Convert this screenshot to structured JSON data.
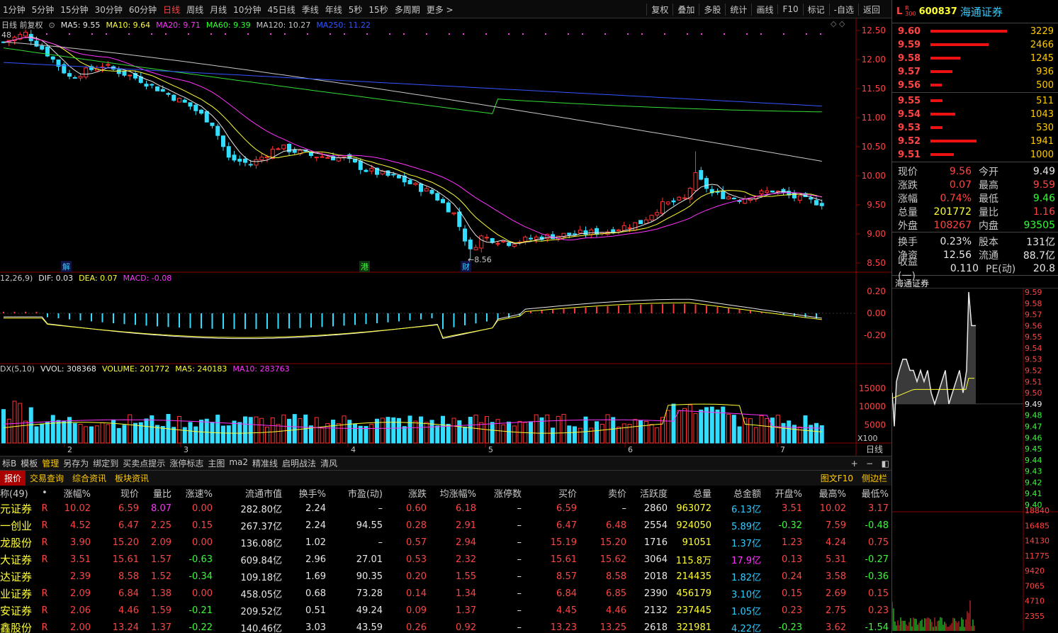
{
  "toolbar": {
    "periods": [
      "1分钟",
      "5分钟",
      "15分钟",
      "30分钟",
      "60分钟",
      "日线",
      "周线",
      "月线",
      "10分钟",
      "45日线",
      "季线",
      "年线",
      "5秒",
      "15秒",
      "多周期",
      "更多"
    ],
    "active_period": "日线",
    "right_tools": [
      "复权",
      "叠加",
      "多股",
      "统计",
      "画线",
      "F10",
      "标记",
      "-自选",
      "返回"
    ]
  },
  "legend_main": {
    "title": "日线 前复权",
    "ma5": "MA5: 9.55",
    "ma10": "MA10: 9.64",
    "ma20": "MA20: 9.71",
    "ma60": "MA60: 9.39",
    "ma120": "MA120: 10.27",
    "ma250": "MA250: 11.22",
    "high_label": "48",
    "low_label": "8.56"
  },
  "legend_macd": {
    "params": "12,26,9)",
    "dif": "DIF: 0.03",
    "dea": "DEA: 0.07",
    "macd": "MACD: -0.08"
  },
  "legend_vol": {
    "params": "DX(5,10)",
    "vvol": "VVOL: 308368",
    "volume": "VOLUME: 201772",
    "ma5": "MA5: 240183",
    "ma10": "MA10: 283763"
  },
  "markers": {
    "jie": "解",
    "gang": "港",
    "cai": "财"
  },
  "axis": {
    "price_ticks": [
      "12.50",
      "12.00",
      "11.50",
      "11.00",
      "10.50",
      "10.00",
      "9.50",
      "9.00",
      "8.50"
    ],
    "macd_ticks": [
      "0.20",
      "0.00",
      "-0.20"
    ],
    "vol_ticks": [
      "15000",
      "10000",
      "5000"
    ],
    "vol_unit": "X100",
    "month_labels": [
      "2",
      "3",
      "4",
      "5",
      "6",
      "7"
    ],
    "period_label": "日线"
  },
  "tool_row": [
    "标B",
    "模板",
    "管理",
    "另存为",
    "绑定到",
    "买卖点提示",
    "涨停标志",
    "主图",
    "ma2",
    "精准线",
    "启明战法",
    "清风"
  ],
  "tool_row_active": "管理",
  "tab_row": [
    "报价",
    "交易查询",
    "综合资讯",
    "板块资讯"
  ],
  "tab_row_right": [
    "图文F10",
    "侧边栏"
  ],
  "table": {
    "count": "(49)",
    "headers": [
      "称",
      "•",
      "涨幅%",
      "现价",
      "量比",
      "涨速%",
      "流通市值",
      "换手%",
      "市盈(动)",
      "涨跌",
      "均涨幅%",
      "涨停数",
      "买价",
      "卖价",
      "活跃度",
      "总量",
      "总金额",
      "开盘%",
      "最高%",
      "最低%"
    ],
    "rows": [
      [
        "元证券",
        "R",
        "10.02",
        "6.59",
        "8.07",
        "0.00",
        "282.80亿",
        "2.24",
        "–",
        "0.60",
        "6.18",
        "–",
        "6.59",
        "–",
        "2860",
        "963072",
        "6.13亿",
        "3.51",
        "10.02",
        "3.17"
      ],
      [
        "一创业",
        "R",
        "4.52",
        "6.47",
        "2.25",
        "0.15",
        "267.37亿",
        "2.24",
        "94.55",
        "0.28",
        "2.91",
        "–",
        "6.47",
        "6.48",
        "2554",
        "924050",
        "5.89亿",
        "-0.32",
        "7.59",
        "-0.48"
      ],
      [
        "龙股份",
        "R",
        "3.90",
        "15.20",
        "2.09",
        "0.00",
        "136.08亿",
        "1.02",
        "–",
        "0.57",
        "2.94",
        "–",
        "15.19",
        "15.20",
        "1716",
        "91051",
        "1.37亿",
        "1.23",
        "4.24",
        "0.75"
      ],
      [
        "大证券",
        "R",
        "3.51",
        "15.61",
        "1.57",
        "-0.63",
        "609.84亿",
        "2.96",
        "27.01",
        "0.53",
        "2.32",
        "–",
        "15.61",
        "15.62",
        "3064",
        "115.8万",
        "17.9亿",
        "0.13",
        "5.31",
        "-0.27"
      ],
      [
        "达证券",
        "",
        "2.39",
        "8.58",
        "1.52",
        "-0.34",
        "109.18亿",
        "1.69",
        "90.35",
        "0.20",
        "1.55",
        "–",
        "8.57",
        "8.58",
        "2018",
        "214435",
        "1.82亿",
        "0.24",
        "3.58",
        "-0.36"
      ],
      [
        "业证券",
        "R",
        "2.09",
        "6.84",
        "1.38",
        "0.00",
        "458.05亿",
        "0.68",
        "73.28",
        "0.14",
        "1.34",
        "–",
        "6.84",
        "6.85",
        "2390",
        "456179",
        "3.10亿",
        "0.15",
        "2.69",
        "0.15"
      ],
      [
        "安证券",
        "R",
        "2.06",
        "4.46",
        "1.59",
        "-0.21",
        "209.52亿",
        "0.51",
        "49.24",
        "0.09",
        "1.37",
        "–",
        "4.45",
        "4.46",
        "2132",
        "237445",
        "1.05亿",
        "0.23",
        "2.75",
        "0.23"
      ],
      [
        "鑫股份",
        "R",
        "2.00",
        "13.24",
        "1.37",
        "-0.22",
        "140.46亿",
        "3.03",
        "43.59",
        "0.26",
        "0.92",
        "–",
        "13.23",
        "13.25",
        "2618",
        "321981",
        "4.22亿",
        "-0.23",
        "3.62",
        "-1.54"
      ]
    ]
  },
  "stock": {
    "l_badge": "L",
    "r_badge": "R",
    "code": "600837",
    "name": "海通证券",
    "sub": "300"
  },
  "order_book": {
    "asks": [
      {
        "price": "9.60",
        "vol": "3229",
        "frac": 1.0
      },
      {
        "price": "9.59",
        "vol": "2466",
        "frac": 0.76
      },
      {
        "price": "9.58",
        "vol": "1245",
        "frac": 0.39
      },
      {
        "price": "9.57",
        "vol": "936",
        "frac": 0.29
      },
      {
        "price": "9.56",
        "vol": "500",
        "frac": 0.15
      }
    ],
    "bids": [
      {
        "price": "9.55",
        "vol": "511",
        "frac": 0.16
      },
      {
        "price": "9.54",
        "vol": "1043",
        "frac": 0.32
      },
      {
        "price": "9.53",
        "vol": "530",
        "frac": 0.16
      },
      {
        "price": "9.52",
        "vol": "1941",
        "frac": 0.6
      },
      {
        "price": "9.51",
        "vol": "1000",
        "frac": 0.31
      }
    ]
  },
  "quote": [
    {
      "k": "现价",
      "v": "9.56",
      "vc": "red",
      "k2": "今开",
      "v2": "9.49",
      "v2c": "white"
    },
    {
      "k": "涨跌",
      "v": "0.07",
      "vc": "red",
      "k2": "最高",
      "v2": "9.59",
      "v2c": "red"
    },
    {
      "k": "涨幅",
      "v": "0.74%",
      "vc": "red",
      "k2": "最低",
      "v2": "9.46",
      "v2c": "green"
    },
    {
      "k": "总量",
      "v": "201772",
      "vc": "yellow",
      "k2": "量比",
      "v2": "1.16",
      "v2c": "red"
    },
    {
      "k": "外盘",
      "v": "108267",
      "vc": "red",
      "k2": "内盘",
      "v2": "93505",
      "v2c": "green"
    }
  ],
  "quote2": [
    {
      "k": "换手",
      "v": "0.23%",
      "k2": "股本",
      "v2": "131亿"
    },
    {
      "k": "净资",
      "v": "12.56",
      "k2": "流通",
      "v2": "88.7亿"
    },
    {
      "k": "收益(一)",
      "v": "0.110",
      "k2": "PE(动)",
      "v2": "20.8"
    }
  ],
  "intraday": {
    "title": "海通证券",
    "price_ticks": [
      "9.59",
      "9.58",
      "9.57",
      "9.56",
      "9.55",
      "9.54",
      "9.53",
      "9.52",
      "9.51",
      "9.50",
      "9.49",
      "9.48",
      "9.47",
      "9.46",
      "9.45",
      "9.44",
      "9.43",
      "9.42",
      "9.41",
      "9.40"
    ],
    "vol_ticks": [
      "18840",
      "16485",
      "14130",
      "11775",
      "9420",
      "7065",
      "4710",
      "2355"
    ]
  }
}
